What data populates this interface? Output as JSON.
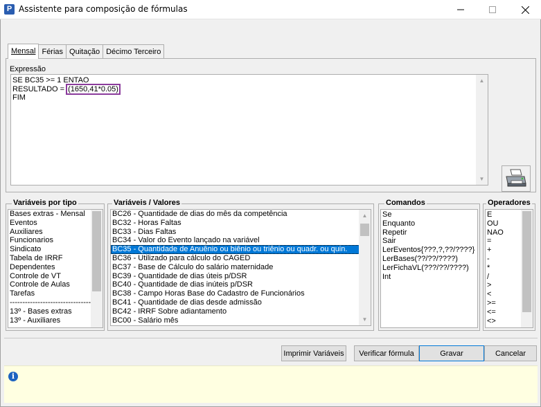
{
  "window": {
    "title": "Assistente para composição de fórmulas",
    "app_icon_letter": "P"
  },
  "tabs": [
    {
      "label": "Mensal",
      "active": true
    },
    {
      "label": "Férias",
      "active": false
    },
    {
      "label": "Quitação",
      "active": false
    },
    {
      "label": "Décimo Terceiro",
      "active": false
    }
  ],
  "expression": {
    "label": "Expressão",
    "lines": [
      "SE BC35 >= 1 ENTAO",
      "RESULTADO = ",
      "FIM"
    ],
    "highlighted_value": "(1650,41*0.05)"
  },
  "groups": {
    "tipos": {
      "title": "Variáveis por tipo",
      "items": [
        "Bases extras - Mensal",
        "Eventos",
        "Auxiliares",
        "Funcionarios",
        "Sindicato",
        "Tabela de IRRF",
        "Dependentes",
        "Controle de VT",
        "Controle de Aulas",
        "Tarefas",
        "-----------------------------------",
        "13º - Bases extras",
        "13º - Auxiliares"
      ]
    },
    "variaveis": {
      "title": "Variáveis / Valores",
      "items": [
        "BC26 - Quantidade de dias do mês da competência",
        "BC32 - Horas Faltas",
        "BC33 - Dias Faltas",
        "BC34 - Valor do Evento lançado na variável",
        "BC35 - Quantidade de Anuênio ou biênio ou triênio ou quadr. ou quin.",
        "BC36 - Utilizado para cálculo do CAGED",
        "BC37 - Base de Cálculo do salário maternidade",
        "BC39 - Quantidade de dias úteis p/DSR",
        "BC40 - Quantidade de dias inúteis p/DSR",
        "BC38 - Campo Horas Base do Cadastro de Funcionários",
        "BC41 - Quantidade de dias desde admissão",
        "BC42 - IRRF Sobre adiantamento",
        "BC00 - Salário mês"
      ],
      "selected_index": 4
    },
    "comandos": {
      "title": "Comandos",
      "items": [
        "Se",
        "Enquanto",
        "Repetir",
        "Sair",
        "LerEventos{???,?,??/????}",
        "LerBases(??/??/????)",
        "LerFichaVL(???/??/????)",
        "Int"
      ]
    },
    "operadores": {
      "title": "Operadores",
      "items": [
        "E",
        "OU",
        "NAO",
        "=",
        "+",
        "-",
        "*",
        "/",
        ">",
        "<",
        ">=",
        "<=",
        "<>"
      ]
    }
  },
  "buttons": {
    "imprimir": "Imprimir Variáveis",
    "verificar": "Verificar fórmula",
    "gravar": "Gravar",
    "cancelar": "Cancelar"
  },
  "status": {
    "icon": "info-icon",
    "text": ""
  },
  "colors": {
    "selection": "#0078d7",
    "highlight_border": "#8b3b9c",
    "status_background": "#ffffe1"
  }
}
